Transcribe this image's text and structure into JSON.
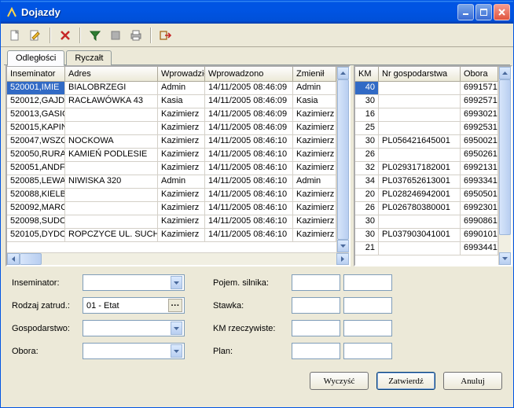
{
  "window": {
    "title": "Dojazdy"
  },
  "tabs": {
    "items": [
      "Odległości",
      "Ryczałt"
    ],
    "active": 0
  },
  "gridLeft": {
    "headers": [
      "Inseminator",
      "Adres",
      "Wprowadził",
      "Wprowadzono",
      "Zmienił"
    ],
    "widths": [
      74,
      118,
      60,
      112,
      55
    ],
    "rows": [
      [
        "520001,IMIE",
        "BIALOBRZEGI",
        "Admin",
        "14/11/2005 08:46:09",
        "Admin"
      ],
      [
        "520012,GAJD",
        "RACŁAWÓWKA 43",
        "Kasia",
        "14/11/2005 08:46:09",
        "Kasia"
      ],
      [
        "520013,GASIO",
        "",
        "Kazimierz",
        "14/11/2005 08:46:09",
        "Kazimierz"
      ],
      [
        "520015,KAPIN",
        "",
        "Kazimierz",
        "14/11/2005 08:46:09",
        "Kazimierz"
      ],
      [
        "520047,WSZO",
        "NOCKOWA",
        "Kazimierz",
        "14/11/2005 08:46:10",
        "Kazimierz"
      ],
      [
        "520050,RURA",
        "KAMIEŃ PODLESIE",
        "Kazimierz",
        "14/11/2005 08:46:10",
        "Kazimierz"
      ],
      [
        "520051,ANDF",
        "",
        "Kazimierz",
        "14/11/2005 08:46:10",
        "Kazimierz"
      ],
      [
        "520085,LEWA",
        "NIWISKA 320",
        "Admin",
        "14/11/2005 08:46:10",
        "Admin"
      ],
      [
        "520088,KIELB",
        "",
        "Kazimierz",
        "14/11/2005 08:46:10",
        "Kazimierz"
      ],
      [
        "520092,MARC",
        "",
        "Kazimierz",
        "14/11/2005 08:46:10",
        "Kazimierz"
      ],
      [
        "520098,SUDC",
        "",
        "Kazimierz",
        "14/11/2005 08:46:10",
        "Kazimierz"
      ],
      [
        "520105,DYDO",
        "ROPCZYCE UL. SUCH",
        "Kazimierz",
        "14/11/2005 08:46:10",
        "Kazimierz"
      ]
    ],
    "selectedRow": 0,
    "selectedCol": 0
  },
  "gridRight": {
    "headers": [
      "KM",
      "Nr gospodarstwa",
      "Obora"
    ],
    "widths": [
      30,
      104,
      48
    ],
    "rows": [
      [
        "40",
        "",
        "6991571"
      ],
      [
        "30",
        "",
        "6992571"
      ],
      [
        "16",
        "",
        "6993021"
      ],
      [
        "25",
        "",
        "6992531"
      ],
      [
        "30",
        "PL056421645001",
        "6950021"
      ],
      [
        "26",
        "",
        "6950261"
      ],
      [
        "32",
        "PL029317182001",
        "6992131"
      ],
      [
        "34",
        "PL037652613001",
        "6993341"
      ],
      [
        "20",
        "PL028246942001",
        "6950501"
      ],
      [
        "26",
        "PL026780380001",
        "6992301"
      ],
      [
        "30",
        "",
        "6990861"
      ],
      [
        "30",
        "PL037903041001",
        "6990101"
      ],
      [
        "21",
        "",
        "6993441"
      ]
    ],
    "selectedRow": 0,
    "selectedCol": 0
  },
  "form": {
    "left": {
      "inseminator": {
        "label": "Inseminator:",
        "value": ""
      },
      "rodzaj": {
        "label": "Rodzaj zatrud.:",
        "value": "01 - Etat"
      },
      "gospodarstwo": {
        "label": "Gospodarstwo:",
        "value": ""
      },
      "obora": {
        "label": "Obora:",
        "value": ""
      }
    },
    "right": {
      "pojem": {
        "label": "Pojem. silnika:"
      },
      "stawka": {
        "label": "Stawka:"
      },
      "km": {
        "label": "KM rzeczywiste:"
      },
      "plan": {
        "label": "Plan:"
      }
    }
  },
  "buttons": {
    "clear": "Wyczyść",
    "confirm": "Zatwierdź",
    "cancel": "Anuluj"
  }
}
